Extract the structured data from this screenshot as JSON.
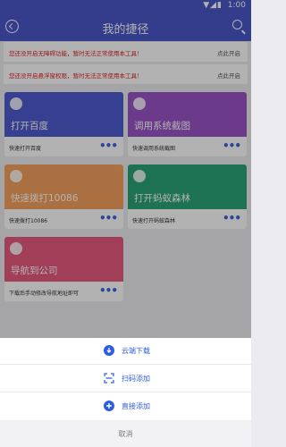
{
  "status_bar": {
    "time": "1:00",
    "icons": "▼◢▮"
  },
  "app_bar": {
    "title": "我的捷径"
  },
  "notices": [
    {
      "message": "您还没开启无障碍功能，暂时无法正常使用本工具！",
      "action": "点此开启"
    },
    {
      "message": "您还没开启悬浮窗权限，暂时无法正常使用本工具！",
      "action": "点此开启"
    }
  ],
  "cards": [
    {
      "name": "打开百度",
      "desc": "快速打开百度",
      "color": "#4f5ccf"
    },
    {
      "name": "调用系统截图",
      "desc": "快速调用系统截图",
      "color": "#9a54c8"
    },
    {
      "name": "快速拨打10086",
      "desc": "快速拨打10086",
      "color": "#f5a15d"
    },
    {
      "name": "打开蚂蚁森林",
      "desc": "快速打开蚂蚁森林",
      "color": "#2aa478"
    },
    {
      "name": "导航到公司",
      "desc": "下载后手动修改导航地址即可",
      "color": "#e85b7e"
    }
  ],
  "more_label": "•••",
  "sheet": {
    "items": [
      {
        "label": "云端下载",
        "icon": "cloud-download-icon"
      },
      {
        "label": "扫码添加",
        "icon": "scan-icon"
      },
      {
        "label": "直接添加",
        "icon": "add-circle-icon"
      }
    ],
    "cancel": "取消"
  }
}
